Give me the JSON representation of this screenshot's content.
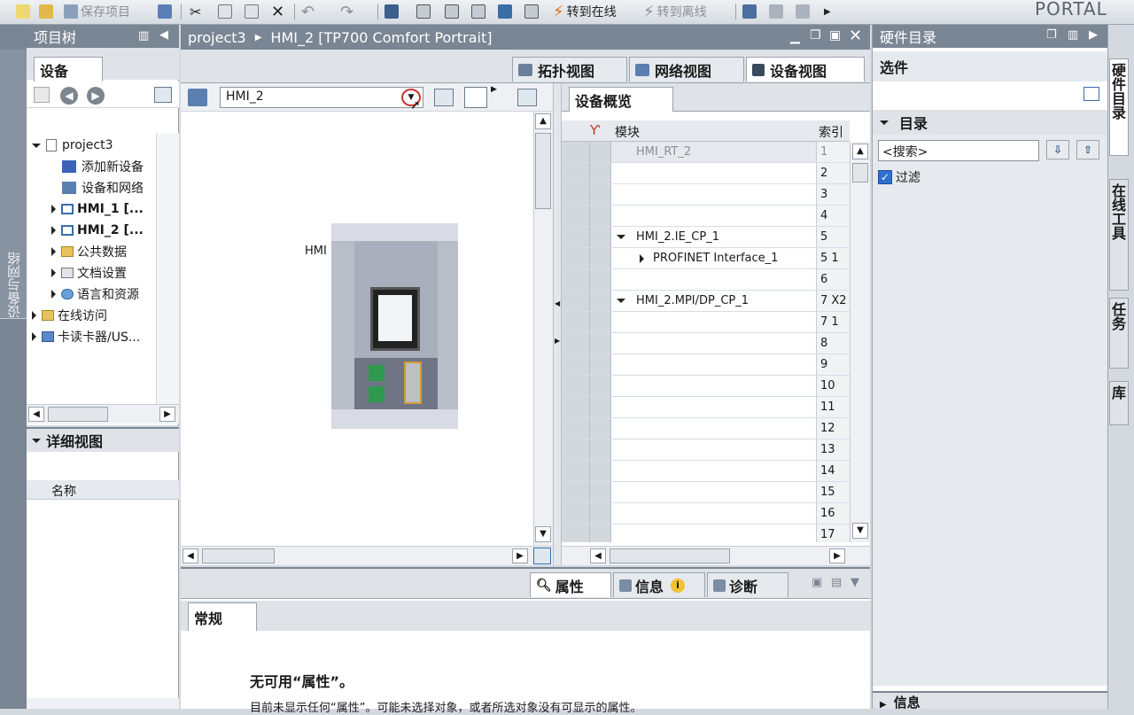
{
  "toolbar": {
    "save_project": "保存项目",
    "go_online": "转到在线",
    "go_offline": "转到离线",
    "portal": "PORTAL"
  },
  "left_strip": {
    "label": "设备与网络"
  },
  "project_tree": {
    "title": "项目树",
    "tab": "设备",
    "items": [
      {
        "label": "project3"
      },
      {
        "label": "添加新设备"
      },
      {
        "label": "设备和网络"
      },
      {
        "label": "HMI_1 [..."
      },
      {
        "label": "HMI_2 [..."
      },
      {
        "label": "公共数据"
      },
      {
        "label": "文档设置"
      },
      {
        "label": "语言和资源"
      },
      {
        "label": "在线访问"
      },
      {
        "label": "卡读卡器/US..."
      }
    ]
  },
  "detail_view": {
    "title": "详细视图",
    "col_name": "名称"
  },
  "editor": {
    "breadcrumb_project": "project3",
    "breadcrumb_device": "HMI_2 [TP700 Comfort Portrait]",
    "tabs": [
      "拓扑视图",
      "网络视图",
      "设备视图"
    ],
    "device_select": "HMI_2",
    "canvas_label": "HMI"
  },
  "overview": {
    "tab": "设备概览",
    "col_module": "模块",
    "col_index": "索引",
    "rows": [
      {
        "module": "HMI_RT_2",
        "index": "1"
      },
      {
        "module": "",
        "index": "2"
      },
      {
        "module": "",
        "index": "3"
      },
      {
        "module": "",
        "index": "4"
      },
      {
        "module": "HMI_2.IE_CP_1",
        "index": "5"
      },
      {
        "module": "PROFINET Interface_1",
        "index": "5 1"
      },
      {
        "module": "",
        "index": "6"
      },
      {
        "module": "HMI_2.MPI/DP_CP_1",
        "index": "7 X2"
      },
      {
        "module": "",
        "index": "7 1"
      },
      {
        "module": "",
        "index": "8"
      },
      {
        "module": "",
        "index": "9"
      },
      {
        "module": "",
        "index": "10"
      },
      {
        "module": "",
        "index": "11"
      },
      {
        "module": "",
        "index": "12"
      },
      {
        "module": "",
        "index": "13"
      },
      {
        "module": "",
        "index": "14"
      },
      {
        "module": "",
        "index": "15"
      },
      {
        "module": "",
        "index": "16"
      },
      {
        "module": "",
        "index": "17"
      }
    ]
  },
  "inspector": {
    "tabs": [
      "属性",
      "信息",
      "诊断"
    ],
    "subtab": "常规",
    "heading": "无可用“属性”。",
    "text": "目前未显示任何“属性”。可能未选择对象，或者所选对象没有可显示的属性。"
  },
  "hw_catalog": {
    "title": "硬件目录",
    "options": "选件",
    "catalog": "目录",
    "search_placeholder": "<搜索>",
    "filter": "过滤",
    "info": "信息"
  },
  "right_tabs": [
    "硬件目录",
    "在线工具",
    "任务",
    "库"
  ]
}
